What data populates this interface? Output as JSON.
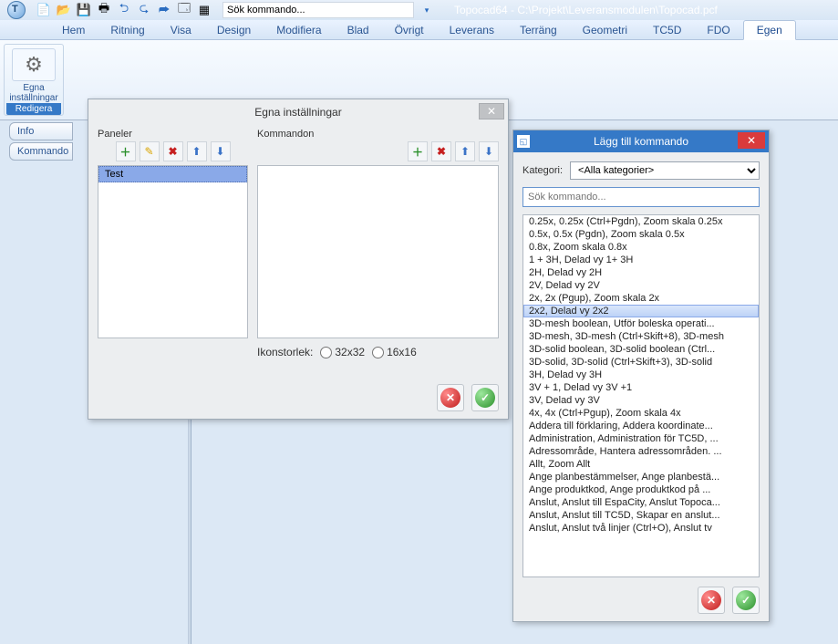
{
  "app": {
    "title": "Topocad64 - C:\\Projekt\\Leveransmodulen\\Topocad.pcf",
    "search_placeholder": "Sök kommando..."
  },
  "ribbon": {
    "tabs": [
      "Hem",
      "Ritning",
      "Visa",
      "Design",
      "Modifiera",
      "Blad",
      "Övrigt",
      "Leverans",
      "Terräng",
      "Geometri",
      "TC5D",
      "FDO",
      "Egen"
    ],
    "active_tab": "Egen",
    "group_label": "Egna\ninställningar",
    "group_band": "Redigera"
  },
  "side_tabs": [
    "Info",
    "Kommando"
  ],
  "dlg1": {
    "title": "Egna inställningar",
    "panels_label": "Paneler",
    "commands_label": "Kommandon",
    "panel_items": [
      "Test"
    ],
    "iconsize_label": "Ikonstorlek:",
    "iconsize_opts": [
      "32x32",
      "16x16"
    ]
  },
  "dlg2": {
    "title": "Lägg till kommando",
    "category_label": "Kategori:",
    "category_value": "<Alla kategorier>",
    "search_placeholder": "Sök kommando...",
    "selected_index": 6,
    "commands": [
      "0.25x, 0.25x (Ctrl+Pgdn), Zoom skala 0.25x",
      "0.5x, 0.5x (Pgdn), Zoom skala 0.5x",
      "0.8x, Zoom skala 0.8x",
      "1 + 3H, Delad vy 1+ 3H",
      "2H, Delad vy 2H",
      "2V, Delad vy 2V",
      "2x, 2x (Pgup), Zoom skala 2x",
      "2x2, Delad vy 2x2",
      "3D-mesh boolean, Utför boleska operati...",
      "3D-mesh, 3D-mesh (Ctrl+Skift+8), 3D-mesh",
      "3D-solid boolean, 3D-solid boolean (Ctrl...",
      "3D-solid, 3D-solid (Ctrl+Skift+3), 3D-solid",
      "3H, Delad vy 3H",
      "3V + 1, Delad vy 3V +1",
      "3V, Delad vy 3V",
      "4x, 4x (Ctrl+Pgup), Zoom skala 4x",
      "Addera till förklaring, Addera koordinate...",
      "Administration, Administration för TC5D, ...",
      "Adressområde, Hantera adressområden. ...",
      "Allt, Zoom Allt",
      "Ange planbestämmelser, Ange planbestä...",
      "Ange produktkod, Ange produktkod på ...",
      "Anslut, Anslut till EspaCity, Anslut Topoca...",
      "Anslut, Anslut till TC5D, Skapar en anslut...",
      "Anslut, Anslut två linjer (Ctrl+O), Anslut tv"
    ]
  }
}
